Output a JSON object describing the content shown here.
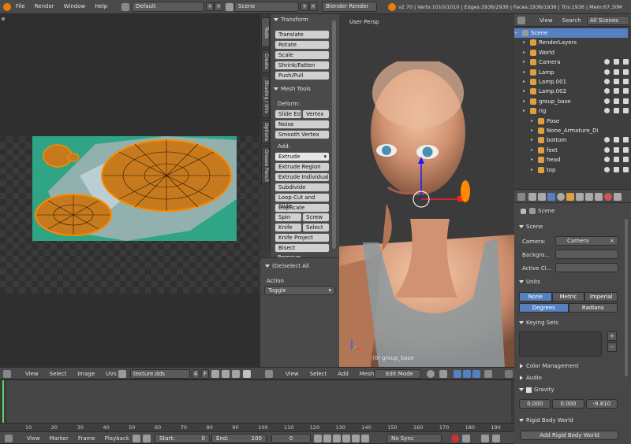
{
  "topbar": {
    "menus": [
      "File",
      "Render",
      "Window",
      "Help"
    ],
    "layout": "Default",
    "scene": "Scene",
    "engine": "Blender Render",
    "stats": "v2.70 | Verts:1010/1010 | Edges:2936/2936 | Faces:1936/1936 | Tris:1936 | Mem:67.30M"
  },
  "uv_editor": {
    "menus": [
      "View",
      "Select",
      "Image",
      "UVs"
    ],
    "image_name": "texture.dds",
    "user_count": "4",
    "fake": "F"
  },
  "tool_tabs": [
    "Tools",
    "Create",
    "Shading / UVs",
    "Options",
    "Grease Pencil"
  ],
  "tool_shelf": {
    "transform_title": "Transform",
    "transform_buttons": [
      "Translate",
      "Rotate",
      "Scale",
      "Shrink/Fatten",
      "Push/Pull"
    ],
    "mesh_tools_title": "Mesh Tools",
    "deform_label": "Deform:",
    "slide_edge": "Slide Ed",
    "vertex": "Vertex",
    "noise": "Noise",
    "smooth_vertex": "Smooth Vertex",
    "add_label": "Add:",
    "extrude": "Extrude",
    "add_buttons": [
      "Extrude Region",
      "Extrude Individual",
      "Subdivide",
      "Loop Cut and Slide",
      "Duplicate"
    ],
    "spin": "Spin",
    "screw": "Screw",
    "knife": "Knife",
    "select": "Select",
    "knife_project": "Knife Project",
    "bisect": "Bisect",
    "remove_label": "Remove:",
    "operator_title": "(De)select All",
    "action_label": "Action",
    "action_value": "Toggle"
  },
  "viewport": {
    "view_name": "User Persp",
    "object_label": "(0) group_base",
    "menus": [
      "View",
      "Select",
      "Add",
      "Mesh"
    ],
    "mode": "Edit Mode"
  },
  "outliner": {
    "menus": [
      "View",
      "Search"
    ],
    "display": "All Scenes",
    "items": [
      {
        "label": "Scene",
        "indent": 0,
        "selected": true
      },
      {
        "label": "RenderLayers",
        "indent": 1
      },
      {
        "label": "World",
        "indent": 1
      },
      {
        "label": "Camera",
        "indent": 1
      },
      {
        "label": "Lamp",
        "indent": 1
      },
      {
        "label": "Lamp.001",
        "indent": 1
      },
      {
        "label": "Lamp.002",
        "indent": 1
      },
      {
        "label": "group_base",
        "indent": 1
      },
      {
        "label": "rig",
        "indent": 1
      },
      {
        "label": "Pose",
        "indent": 2
      },
      {
        "label": "None_Armature_Di",
        "indent": 2
      },
      {
        "label": "bottom",
        "indent": 2
      },
      {
        "label": "feet",
        "indent": 2
      },
      {
        "label": "head",
        "indent": 2
      },
      {
        "label": "top",
        "indent": 2
      }
    ]
  },
  "properties": {
    "breadcrumb": "Scene",
    "scene_panel": "Scene",
    "camera_label": "Camera:",
    "camera_value": "Camera",
    "background_label": "Backgro...",
    "active_clip_label": "Active Cl...",
    "units_panel": "Units",
    "unit_systems": [
      "None",
      "Metric",
      "Imperial"
    ],
    "rotation_units": [
      "Degrees",
      "Radians"
    ],
    "keying_panel": "Keying Sets",
    "color_mgmt": "Color Management",
    "audio": "Audio",
    "gravity": "Gravity",
    "gravity_values": [
      "0.000",
      "0.000",
      "-9.810"
    ],
    "rigid_body": "Rigid Body World",
    "add_rigid_body": "Add Rigid Body World"
  },
  "timeline": {
    "ticks": [
      "10",
      "20",
      "30",
      "40",
      "50",
      "60",
      "70",
      "80",
      "90",
      "100",
      "110",
      "120",
      "130",
      "140",
      "150",
      "160",
      "170",
      "180",
      "190"
    ],
    "menus": [
      "View",
      "Marker",
      "Frame",
      "Playback"
    ],
    "start": "Start:",
    "start_value": "0",
    "end": "End:",
    "end_value": "100",
    "current_frame": "0",
    "sync": "No Sync"
  },
  "colors": {
    "accent": "#5680c2",
    "uv_orange": "#ff8a00",
    "teal": "#2fa586"
  }
}
